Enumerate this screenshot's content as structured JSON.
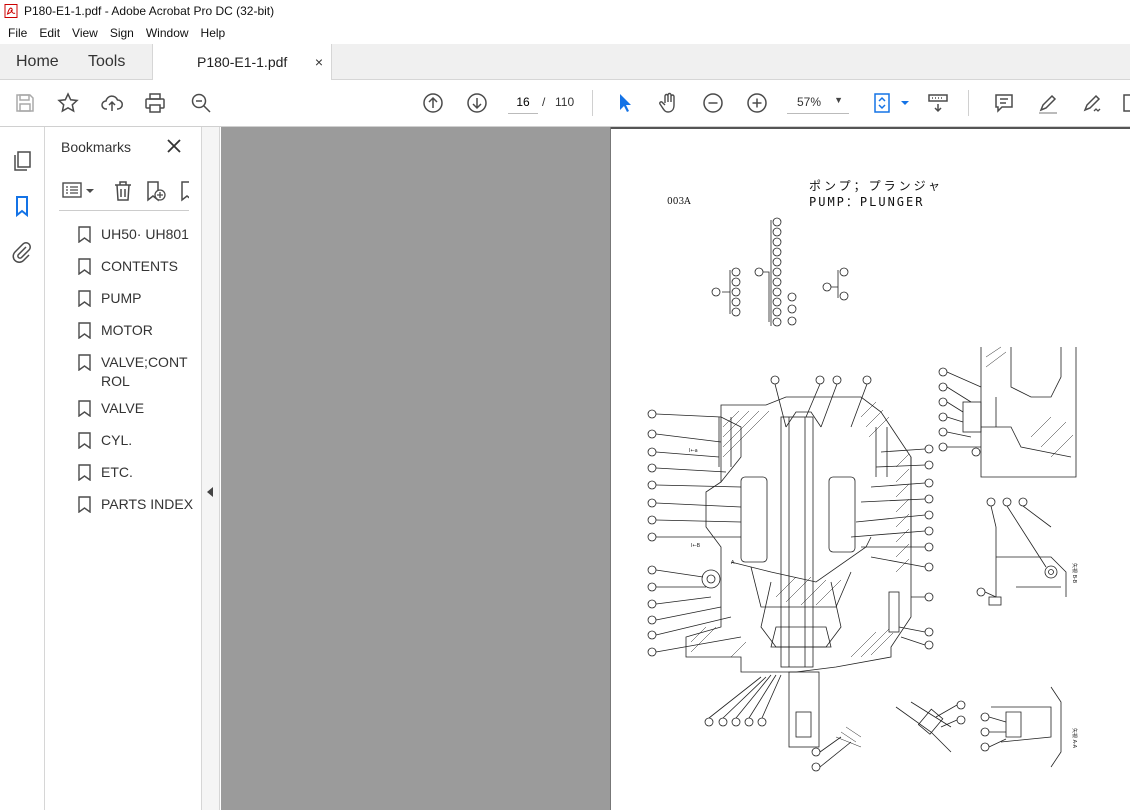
{
  "window": {
    "title": "P180-E1-1.pdf - Adobe Acrobat Pro DC (32-bit)"
  },
  "menu": [
    "File",
    "Edit",
    "View",
    "Sign",
    "Window",
    "Help"
  ],
  "tabs": {
    "home": "Home",
    "tools": "Tools",
    "document": "P180-E1-1.pdf",
    "close": "×"
  },
  "toolbar": {
    "page_current": "16",
    "page_sep": "/",
    "page_total": "110",
    "zoom": "57%"
  },
  "bookmarks": {
    "title": "Bookmarks",
    "items": [
      {
        "label": "UH50· UH801"
      },
      {
        "label": "CONTENTS"
      },
      {
        "label": "PUMP"
      },
      {
        "label": "MOTOR"
      },
      {
        "label": "VALVE;CONTROL"
      },
      {
        "label": "VALVE"
      },
      {
        "label": "CYL."
      },
      {
        "label": "ETC."
      },
      {
        "label": "PARTS INDEX"
      }
    ]
  },
  "document": {
    "jp_title": "ポンプ；プランジャ",
    "en_title": "PUMP：PLUNGER",
    "figure_code": "003A"
  },
  "colors": {
    "accent": "#1473e6",
    "doc_bg": "#9b9b9b",
    "toolbar_icon": "#4b4b4b"
  }
}
